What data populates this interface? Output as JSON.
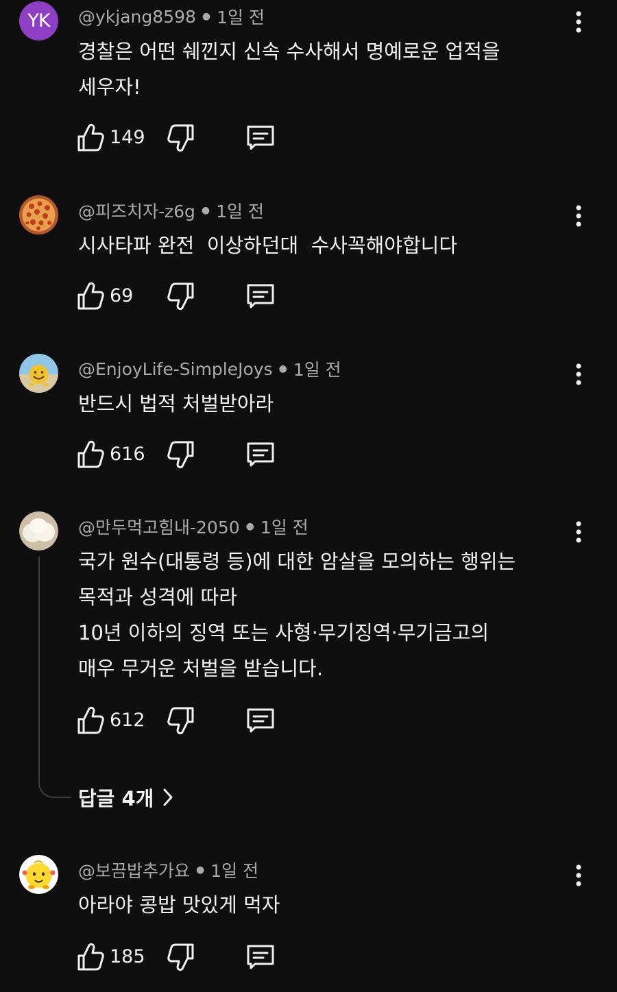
{
  "comments": [
    {
      "avatar_initials": "YK",
      "avatar_kind": "initials",
      "author": "@ykjang8598",
      "time": "1일 전",
      "lines": [
        "경찰은 어떤 쉐낀지 신속 수사해서 명예로운 업적을",
        "세우자!"
      ],
      "likes": "149"
    },
    {
      "avatar_kind": "pizza-image",
      "author": "@피즈치자-z6g",
      "time": "1일 전",
      "lines": [
        "시사타파 완전  이상하던대  수사꼭해야합니다"
      ],
      "likes": "69"
    },
    {
      "avatar_kind": "smiley-beach-image",
      "author": "@EnjoyLife-SimpleJoys",
      "time": "1일 전",
      "lines": [
        "반드시 법적 처벌받아라"
      ],
      "likes": "616"
    },
    {
      "avatar_kind": "dumpling-image",
      "author": "@만두먹고힘내-2050",
      "time": "1일 전",
      "lines": [
        "국가 원수(대통령 등)에 대한 암살을 모의하는 행위는",
        "목적과 성격에 따라",
        "10년 이하의 징역 또는 사형·무기징역·무기금고의",
        "매우 무거운 처벌을 받습니다."
      ],
      "likes": "612",
      "replies_label": "답글 4개"
    },
    {
      "avatar_kind": "yellow-character-image",
      "author": "@보끔밥추가요",
      "time": "1일 전",
      "lines": [
        "아라야 콩밥 맛있게 먹자"
      ],
      "likes": "185"
    }
  ],
  "icons": {
    "like": "thumb-up-icon",
    "dislike": "thumb-down-icon",
    "reply": "comment-reply-icon",
    "more": "more-vertical-icon",
    "chevron": "chevron-right-icon"
  },
  "colors": {
    "background": "#0f0f0f",
    "text": "#f1f1f1",
    "meta": "#aaaaaa",
    "initials_avatar": "#8f3fc4"
  }
}
